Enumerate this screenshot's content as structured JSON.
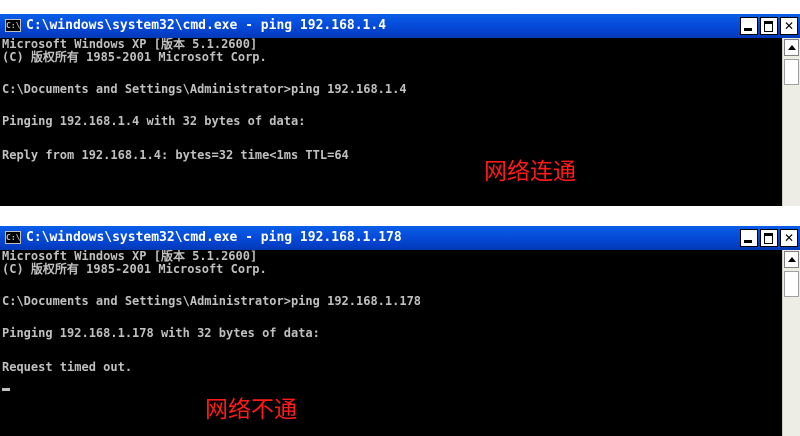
{
  "windows": [
    {
      "title": "C:\\windows\\system32\\cmd.exe - ping 192.168.1.4",
      "icon": "C:\\",
      "lines": [
        "Microsoft Windows XP [版本 5.1.2600]",
        "(C) 版权所有 1985-2001 Microsoft Corp.",
        "",
        "C:\\Documents and Settings\\Administrator>ping 192.168.1.4",
        "",
        "Pinging 192.168.1.4 with 32 bytes of data:",
        "",
        "Reply from 192.168.1.4: bytes=32 time<1ms TTL=64"
      ],
      "annotation": "网络连通"
    },
    {
      "title": "C:\\windows\\system32\\cmd.exe - ping 192.168.1.178",
      "icon": "C:\\",
      "lines": [
        "Microsoft Windows XP [版本 5.1.2600]",
        "(C) 版权所有 1985-2001 Microsoft Corp.",
        "",
        "C:\\Documents and Settings\\Administrator>ping 192.168.1.178",
        "",
        "Pinging 192.168.1.178 with 32 bytes of data:",
        "",
        "Request timed out."
      ],
      "annotation": "网络不通"
    }
  ],
  "icons": {
    "window_icon": "cmd-icon",
    "minimize": "minimize-icon",
    "maximize": "maximize-icon",
    "close": "close-icon",
    "scroll_up": "scroll-up-arrow-icon"
  },
  "colors": {
    "titlebar": "#0548d6",
    "console_bg": "#000000",
    "console_text": "#c0c0c0",
    "annotation": "#ff1a1a"
  }
}
